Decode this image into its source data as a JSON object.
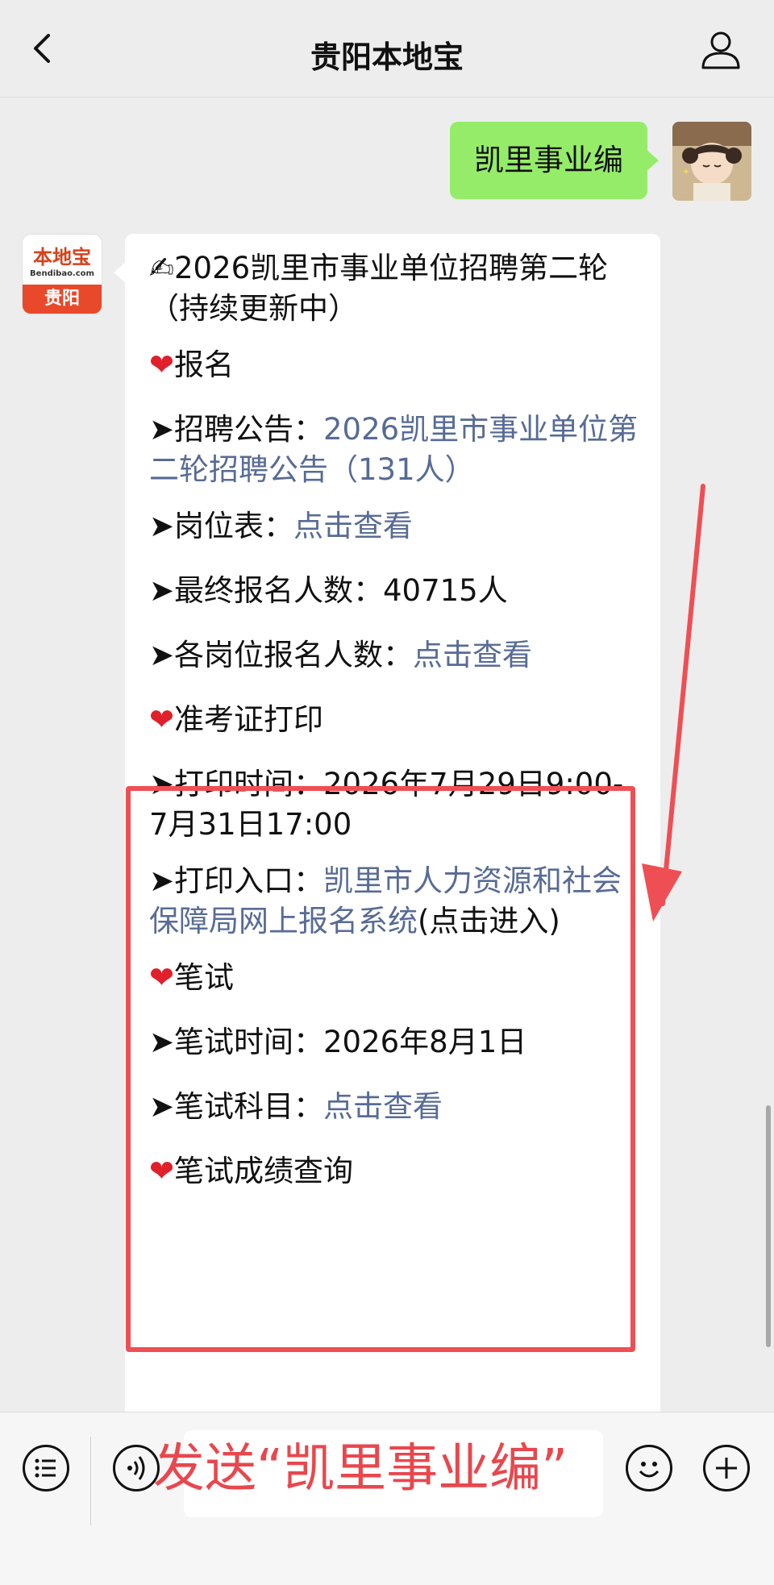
{
  "header": {
    "title": "贵阳本地宝"
  },
  "user_message": "凯里事业编",
  "bot_avatar": {
    "logo_main": "本地宝",
    "logo_sub": "Bendibao.com",
    "city": "贵阳"
  },
  "bot_message": {
    "title_icon": "✍",
    "title": "2026凯里市事业单位招聘第二轮（持续更新中）",
    "section_signup": {
      "heading": "报名",
      "notice_label": "➤招聘公告：",
      "notice_link": "2026凯里市事业单位第二轮招聘公告（131人）",
      "positions_label": "➤岗位表：",
      "positions_link": "点击查看",
      "final_count_label": "➤最终报名人数：",
      "final_count_value": "40715人",
      "each_count_label": "➤各岗位报名人数：",
      "each_count_link": "点击查看"
    },
    "section_admission": {
      "heading": "准考证打印",
      "print_time_label": "➤打印时间：",
      "print_time_value": "2026年7月29日9:00-7月31日17:00",
      "print_entry_label": "➤打印入口：",
      "print_entry_link": "凯里市人力资源和社会保障局网上报名系统",
      "print_entry_suffix": "(点击进入)"
    },
    "section_exam": {
      "heading": "笔试",
      "exam_time_label": "➤笔试时间：",
      "exam_time_value": "2026年8月1日",
      "exam_subject_label": "➤笔试科目：",
      "exam_subject_link": "点击查看"
    },
    "section_score": {
      "heading": "笔试成绩查询"
    }
  },
  "input_overlay": "发送“凯里事业编”",
  "colors": {
    "link": "#576b95",
    "user_bubble": "#95ec69",
    "highlight": "#ee4f55",
    "heart": "#e0202a"
  }
}
